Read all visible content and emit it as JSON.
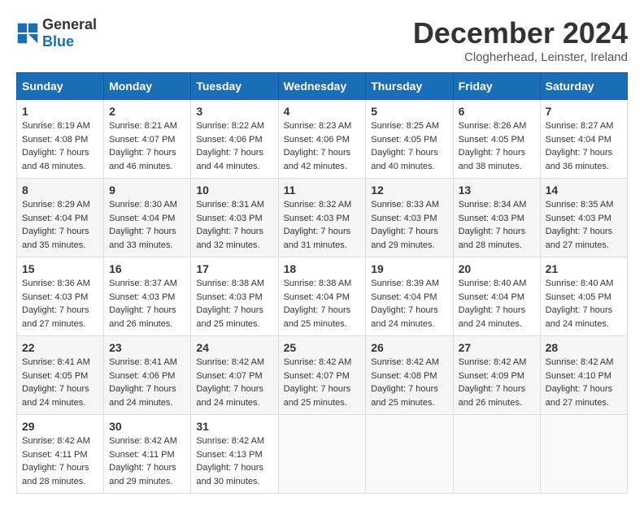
{
  "logo": {
    "general": "General",
    "blue": "Blue"
  },
  "header": {
    "month": "December 2024",
    "location": "Clogherhead, Leinster, Ireland"
  },
  "days_of_week": [
    "Sunday",
    "Monday",
    "Tuesday",
    "Wednesday",
    "Thursday",
    "Friday",
    "Saturday"
  ],
  "weeks": [
    [
      {
        "day": "1",
        "sunrise": "Sunrise: 8:19 AM",
        "sunset": "Sunset: 4:08 PM",
        "daylight": "Daylight: 7 hours and 48 minutes."
      },
      {
        "day": "2",
        "sunrise": "Sunrise: 8:21 AM",
        "sunset": "Sunset: 4:07 PM",
        "daylight": "Daylight: 7 hours and 46 minutes."
      },
      {
        "day": "3",
        "sunrise": "Sunrise: 8:22 AM",
        "sunset": "Sunset: 4:06 PM",
        "daylight": "Daylight: 7 hours and 44 minutes."
      },
      {
        "day": "4",
        "sunrise": "Sunrise: 8:23 AM",
        "sunset": "Sunset: 4:06 PM",
        "daylight": "Daylight: 7 hours and 42 minutes."
      },
      {
        "day": "5",
        "sunrise": "Sunrise: 8:25 AM",
        "sunset": "Sunset: 4:05 PM",
        "daylight": "Daylight: 7 hours and 40 minutes."
      },
      {
        "day": "6",
        "sunrise": "Sunrise: 8:26 AM",
        "sunset": "Sunset: 4:05 PM",
        "daylight": "Daylight: 7 hours and 38 minutes."
      },
      {
        "day": "7",
        "sunrise": "Sunrise: 8:27 AM",
        "sunset": "Sunset: 4:04 PM",
        "daylight": "Daylight: 7 hours and 36 minutes."
      }
    ],
    [
      {
        "day": "8",
        "sunrise": "Sunrise: 8:29 AM",
        "sunset": "Sunset: 4:04 PM",
        "daylight": "Daylight: 7 hours and 35 minutes."
      },
      {
        "day": "9",
        "sunrise": "Sunrise: 8:30 AM",
        "sunset": "Sunset: 4:04 PM",
        "daylight": "Daylight: 7 hours and 33 minutes."
      },
      {
        "day": "10",
        "sunrise": "Sunrise: 8:31 AM",
        "sunset": "Sunset: 4:03 PM",
        "daylight": "Daylight: 7 hours and 32 minutes."
      },
      {
        "day": "11",
        "sunrise": "Sunrise: 8:32 AM",
        "sunset": "Sunset: 4:03 PM",
        "daylight": "Daylight: 7 hours and 31 minutes."
      },
      {
        "day": "12",
        "sunrise": "Sunrise: 8:33 AM",
        "sunset": "Sunset: 4:03 PM",
        "daylight": "Daylight: 7 hours and 29 minutes."
      },
      {
        "day": "13",
        "sunrise": "Sunrise: 8:34 AM",
        "sunset": "Sunset: 4:03 PM",
        "daylight": "Daylight: 7 hours and 28 minutes."
      },
      {
        "day": "14",
        "sunrise": "Sunrise: 8:35 AM",
        "sunset": "Sunset: 4:03 PM",
        "daylight": "Daylight: 7 hours and 27 minutes."
      }
    ],
    [
      {
        "day": "15",
        "sunrise": "Sunrise: 8:36 AM",
        "sunset": "Sunset: 4:03 PM",
        "daylight": "Daylight: 7 hours and 27 minutes."
      },
      {
        "day": "16",
        "sunrise": "Sunrise: 8:37 AM",
        "sunset": "Sunset: 4:03 PM",
        "daylight": "Daylight: 7 hours and 26 minutes."
      },
      {
        "day": "17",
        "sunrise": "Sunrise: 8:38 AM",
        "sunset": "Sunset: 4:03 PM",
        "daylight": "Daylight: 7 hours and 25 minutes."
      },
      {
        "day": "18",
        "sunrise": "Sunrise: 8:38 AM",
        "sunset": "Sunset: 4:04 PM",
        "daylight": "Daylight: 7 hours and 25 minutes."
      },
      {
        "day": "19",
        "sunrise": "Sunrise: 8:39 AM",
        "sunset": "Sunset: 4:04 PM",
        "daylight": "Daylight: 7 hours and 24 minutes."
      },
      {
        "day": "20",
        "sunrise": "Sunrise: 8:40 AM",
        "sunset": "Sunset: 4:04 PM",
        "daylight": "Daylight: 7 hours and 24 minutes."
      },
      {
        "day": "21",
        "sunrise": "Sunrise: 8:40 AM",
        "sunset": "Sunset: 4:05 PM",
        "daylight": "Daylight: 7 hours and 24 minutes."
      }
    ],
    [
      {
        "day": "22",
        "sunrise": "Sunrise: 8:41 AM",
        "sunset": "Sunset: 4:05 PM",
        "daylight": "Daylight: 7 hours and 24 minutes."
      },
      {
        "day": "23",
        "sunrise": "Sunrise: 8:41 AM",
        "sunset": "Sunset: 4:06 PM",
        "daylight": "Daylight: 7 hours and 24 minutes."
      },
      {
        "day": "24",
        "sunrise": "Sunrise: 8:42 AM",
        "sunset": "Sunset: 4:07 PM",
        "daylight": "Daylight: 7 hours and 24 minutes."
      },
      {
        "day": "25",
        "sunrise": "Sunrise: 8:42 AM",
        "sunset": "Sunset: 4:07 PM",
        "daylight": "Daylight: 7 hours and 25 minutes."
      },
      {
        "day": "26",
        "sunrise": "Sunrise: 8:42 AM",
        "sunset": "Sunset: 4:08 PM",
        "daylight": "Daylight: 7 hours and 25 minutes."
      },
      {
        "day": "27",
        "sunrise": "Sunrise: 8:42 AM",
        "sunset": "Sunset: 4:09 PM",
        "daylight": "Daylight: 7 hours and 26 minutes."
      },
      {
        "day": "28",
        "sunrise": "Sunrise: 8:42 AM",
        "sunset": "Sunset: 4:10 PM",
        "daylight": "Daylight: 7 hours and 27 minutes."
      }
    ],
    [
      {
        "day": "29",
        "sunrise": "Sunrise: 8:42 AM",
        "sunset": "Sunset: 4:11 PM",
        "daylight": "Daylight: 7 hours and 28 minutes."
      },
      {
        "day": "30",
        "sunrise": "Sunrise: 8:42 AM",
        "sunset": "Sunset: 4:11 PM",
        "daylight": "Daylight: 7 hours and 29 minutes."
      },
      {
        "day": "31",
        "sunrise": "Sunrise: 8:42 AM",
        "sunset": "Sunset: 4:13 PM",
        "daylight": "Daylight: 7 hours and 30 minutes."
      },
      null,
      null,
      null,
      null
    ]
  ]
}
